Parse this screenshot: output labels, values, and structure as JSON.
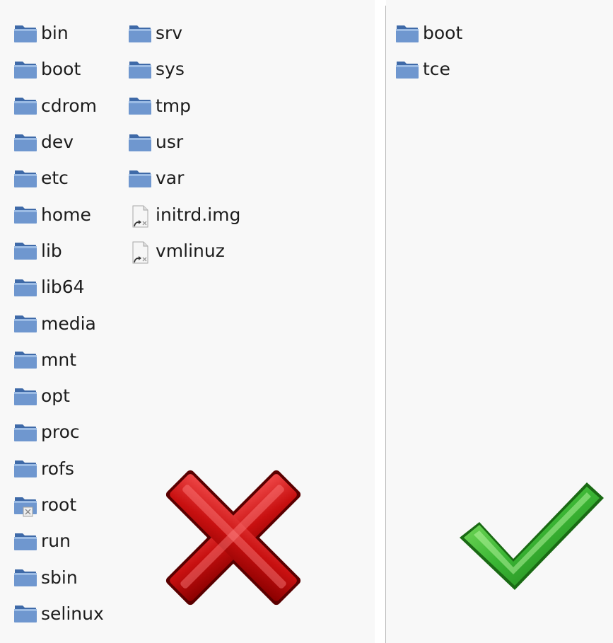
{
  "left_pane": {
    "columns": [
      [
        {
          "name": "bin",
          "type": "folder"
        },
        {
          "name": "boot",
          "type": "folder"
        },
        {
          "name": "cdrom",
          "type": "folder"
        },
        {
          "name": "dev",
          "type": "folder"
        },
        {
          "name": "etc",
          "type": "folder"
        },
        {
          "name": "home",
          "type": "folder"
        },
        {
          "name": "lib",
          "type": "folder"
        },
        {
          "name": "lib64",
          "type": "folder"
        },
        {
          "name": "media",
          "type": "folder"
        },
        {
          "name": "mnt",
          "type": "folder"
        },
        {
          "name": "opt",
          "type": "folder"
        },
        {
          "name": "proc",
          "type": "folder"
        },
        {
          "name": "rofs",
          "type": "folder"
        },
        {
          "name": "root",
          "type": "folder-locked"
        },
        {
          "name": "run",
          "type": "folder"
        },
        {
          "name": "sbin",
          "type": "folder"
        },
        {
          "name": "selinux",
          "type": "folder"
        }
      ],
      [
        {
          "name": "srv",
          "type": "folder"
        },
        {
          "name": "sys",
          "type": "folder"
        },
        {
          "name": "tmp",
          "type": "folder"
        },
        {
          "name": "usr",
          "type": "folder"
        },
        {
          "name": "var",
          "type": "folder"
        },
        {
          "name": "initrd.img",
          "type": "file-link"
        },
        {
          "name": "vmlinuz",
          "type": "file-link"
        }
      ]
    ],
    "mark": "cross-icon"
  },
  "right_pane": {
    "items": [
      {
        "name": "boot",
        "type": "folder"
      },
      {
        "name": "tce",
        "type": "folder"
      }
    ],
    "mark": "checkmark-icon"
  },
  "colors": {
    "folder_blue": "#5d86c2",
    "cross_red": "#d01818",
    "check_green": "#3ab534"
  }
}
